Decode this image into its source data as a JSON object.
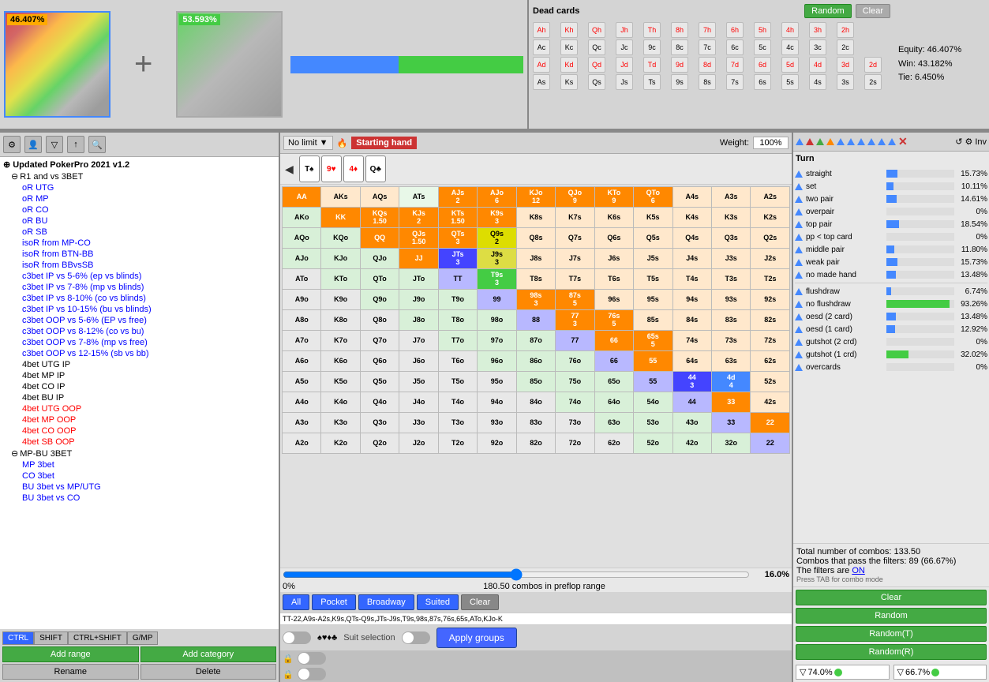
{
  "app": {
    "title": "Updated PokerPro 2021 v1.2"
  },
  "top": {
    "equity_left": "46.407%",
    "equity_right": "53.593%",
    "dead_cards_title": "Dead cards",
    "random_btn": "Random",
    "clear_btn": "Clear",
    "equity_label": "Equity: 46.407%",
    "win_label": "Win: 43.182%",
    "tie_label": "Tie: 6.450%"
  },
  "range_mode": {
    "limit": "No limit",
    "starting_hand": "Starting hand",
    "weight_label": "Weight:",
    "weight_value": "100%"
  },
  "matrix": {
    "rows": [
      "A",
      "K",
      "Q",
      "J",
      "T",
      "9",
      "8",
      "7",
      "6",
      "5",
      "4",
      "3",
      "2"
    ],
    "cols": [
      "A",
      "K",
      "Q",
      "J",
      "T",
      "9",
      "8",
      "7",
      "6",
      "5",
      "4",
      "3",
      "2"
    ]
  },
  "range_info": {
    "combos_label": "180.50 combos in preflop range",
    "pct_label": "16.0%",
    "zero_pct": "0%",
    "range_text": "TT-22,A9s-A2s,K9s,QTs-Q9s,JTs-J9s,T9s,98s,87s,76s,65s,ATo,KJo-K"
  },
  "action_buttons": {
    "all": "All",
    "pocket": "Pocket",
    "broadway": "Broadway",
    "suited": "Suited",
    "clear": "Clear"
  },
  "suit_selection": {
    "label": "Suit selection",
    "apply_groups": "Apply groups"
  },
  "tree": {
    "root": "Updated PokerPro 2021 v1.2",
    "items": [
      {
        "label": "R1 and vs 3BET",
        "indent": 1,
        "style": "normal"
      },
      {
        "label": "oR UTG",
        "indent": 2,
        "style": "blue"
      },
      {
        "label": "oR MP",
        "indent": 2,
        "style": "blue"
      },
      {
        "label": "oR CO",
        "indent": 2,
        "style": "blue"
      },
      {
        "label": "oR BU",
        "indent": 2,
        "style": "blue"
      },
      {
        "label": "oR SB",
        "indent": 2,
        "style": "blue"
      },
      {
        "label": "isoR from MP-CO",
        "indent": 2,
        "style": "blue"
      },
      {
        "label": "isoR from BTN-BB",
        "indent": 2,
        "style": "blue"
      },
      {
        "label": "isoR from BBvsSB",
        "indent": 2,
        "style": "blue"
      },
      {
        "label": "c3bet IP vs 5-6% (ep vs blinds)",
        "indent": 2,
        "style": "blue"
      },
      {
        "label": "c3bet IP vs 7-8% (mp vs blinds)",
        "indent": 2,
        "style": "blue"
      },
      {
        "label": "c3bet IP vs 8-10% (co vs blinds)",
        "indent": 2,
        "style": "blue"
      },
      {
        "label": "c3bet IP vs 10-15% (bu vs blinds)",
        "indent": 2,
        "style": "blue"
      },
      {
        "label": "c3bet OOP vs 5-6% (EP vs free)",
        "indent": 2,
        "style": "blue"
      },
      {
        "label": "c3bet OOP vs 8-12% (co vs bu)",
        "indent": 2,
        "style": "blue"
      },
      {
        "label": "c3bet OOP vs 7-8% (mp vs free)",
        "indent": 2,
        "style": "blue"
      },
      {
        "label": "c3bet OOP vs 12-15% (sb vs bb)",
        "indent": 2,
        "style": "blue"
      },
      {
        "label": "4bet UTG IP",
        "indent": 2,
        "style": "normal"
      },
      {
        "label": "4bet MP IP",
        "indent": 2,
        "style": "normal"
      },
      {
        "label": "4bet CO IP",
        "indent": 2,
        "style": "normal"
      },
      {
        "label": "4bet BU IP",
        "indent": 2,
        "style": "normal"
      },
      {
        "label": "4bet UTG OOP",
        "indent": 2,
        "style": "red"
      },
      {
        "label": "4bet MP OOP",
        "indent": 2,
        "style": "red"
      },
      {
        "label": "4bet CO OOP",
        "indent": 2,
        "style": "red"
      },
      {
        "label": "4bet SB OOP",
        "indent": 2,
        "style": "red"
      },
      {
        "label": "MP-BU 3BET",
        "indent": 1,
        "style": "normal"
      },
      {
        "label": "MP 3bet",
        "indent": 2,
        "style": "blue"
      },
      {
        "label": "CO 3bet",
        "indent": 2,
        "style": "blue"
      },
      {
        "label": "BU 3bet vs MP/UTG",
        "indent": 2,
        "style": "blue"
      },
      {
        "label": "BU 3bet vs CO",
        "indent": 2,
        "style": "blue"
      }
    ]
  },
  "bottom_buttons": {
    "add_range": "Add range",
    "add_category": "Add category",
    "rename": "Rename",
    "delete": "Delete",
    "modes": [
      "CTRL",
      "SHIFT",
      "CTRL+SHIFT",
      "G/MP"
    ]
  },
  "right_panel": {
    "turn_label": "Turn",
    "inv_label": "Inv",
    "board_cards": [
      {
        "rank": "T",
        "suit": "♠",
        "color": "black"
      },
      {
        "rank": "9",
        "suit": "♥",
        "color": "red"
      },
      {
        "rank": "4",
        "suit": "♦",
        "color": "red"
      },
      {
        "rank": "Q",
        "suit": "♣",
        "color": "black"
      }
    ],
    "hand_types": [
      {
        "name": "straight",
        "pct": 15.73,
        "bar_pct": 16
      },
      {
        "name": "set",
        "pct": 10.11,
        "bar_pct": 10
      },
      {
        "name": "two pair",
        "pct": 14.61,
        "bar_pct": 15
      },
      {
        "name": "overpair",
        "pct": 0,
        "bar_pct": 0
      },
      {
        "name": "top pair",
        "pct": 18.54,
        "bar_pct": 19
      },
      {
        "name": "pp < top card",
        "pct": 0,
        "bar_pct": 0
      },
      {
        "name": "middle pair",
        "pct": 11.8,
        "bar_pct": 12
      },
      {
        "name": "weak pair",
        "pct": 15.73,
        "bar_pct": 16
      },
      {
        "name": "no made hand",
        "pct": 13.48,
        "bar_pct": 14
      },
      {
        "name": "flushdraw",
        "pct": 6.74,
        "bar_pct": 7
      },
      {
        "name": "no flushdraw",
        "pct": 93.26,
        "bar_pct": 93,
        "green": true
      },
      {
        "name": "oesd (2 card)",
        "pct": 13.48,
        "bar_pct": 14
      },
      {
        "name": "oesd (1 card)",
        "pct": 12.92,
        "bar_pct": 13
      },
      {
        "name": "gutshot (2 crd)",
        "pct": 0,
        "bar_pct": 0
      },
      {
        "name": "gutshot (1 crd)",
        "pct": 32.02,
        "bar_pct": 32,
        "green": true
      },
      {
        "name": "overcards",
        "pct": 0,
        "bar_pct": 0
      }
    ],
    "total_combos": "Total number of combos: 133.50",
    "filter_combos": "Combos that pass the filters: 89 (66.67%)",
    "filters_on": "The filters are ON",
    "press_tab": "Press TAB for combo mode",
    "clear_btn": "Clear",
    "random_btn": "Random",
    "random_t_btn": "Random(T)",
    "random_r_btn": "Random(R)",
    "filter_f_pct": "74.0%",
    "filter_t_pct": "66.7%"
  },
  "dead_cards": {
    "rows": [
      [
        "Ah",
        "Kh",
        "Qh",
        "Jh",
        "Th",
        "8h",
        "7h",
        "6h",
        "5h",
        "4h",
        "3h",
        "2h"
      ],
      [
        "Ac",
        "Kc",
        "Qc",
        "Jc",
        "9c",
        "8c",
        "7c",
        "6c",
        "5c",
        "4c",
        "3c",
        "2c"
      ],
      [
        "Ad",
        "Kd",
        "Qd",
        "Jd",
        "Td",
        "9d",
        "8d",
        "7d",
        "6d",
        "5d",
        "4d",
        "3d",
        "2d"
      ],
      [
        "As",
        "Ks",
        "Qs",
        "Js",
        "Ts",
        "9s",
        "8s",
        "7s",
        "6s",
        "5s",
        "4s",
        "3s",
        "2s"
      ]
    ]
  }
}
